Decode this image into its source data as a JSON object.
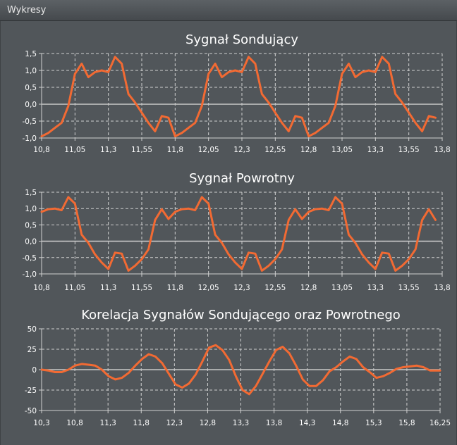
{
  "window": {
    "title": "Wykresy"
  },
  "colors": {
    "series": "#f26a33",
    "zero_line": "#c8c8c8",
    "grid": "#d0d0d0",
    "background": "#51565a"
  },
  "chart_data": [
    {
      "type": "line",
      "title": "Sygnał Sondujący",
      "xlabel": "",
      "ylabel": "",
      "xlim": [
        10.8,
        13.8
      ],
      "ylim": [
        -1.0,
        1.5
      ],
      "xticks": [
        "10,8",
        "11,05",
        "11,3",
        "11,55",
        "11,8",
        "12,05",
        "12,3",
        "12,55",
        "12,8",
        "13,05",
        "13,3",
        "13,55",
        "13,8"
      ],
      "yticks": [
        "1,5",
        "1,0",
        "0,5",
        "0,0",
        "-0,5",
        "-1,0"
      ],
      "grid": true,
      "series": [
        {
          "x": [
            10.8,
            10.85,
            10.9,
            10.95,
            11.0,
            11.05,
            11.1,
            11.15,
            11.2,
            11.25,
            11.3,
            11.35,
            11.4,
            11.45,
            11.5,
            11.55,
            11.6,
            11.65,
            11.7,
            11.75,
            11.8,
            11.85,
            11.9,
            11.95,
            12.0,
            12.05,
            12.1,
            12.15,
            12.2,
            12.25,
            12.3,
            12.35,
            12.4,
            12.45,
            12.5,
            12.55,
            12.6,
            12.65,
            12.7,
            12.75,
            12.8,
            12.85,
            12.9,
            12.95,
            13.0,
            13.05,
            13.1,
            13.15,
            13.2,
            13.25,
            13.3,
            13.35,
            13.4,
            13.45,
            13.5,
            13.55,
            13.6,
            13.65,
            13.7,
            13.75
          ],
          "y": [
            -0.95,
            -0.85,
            -0.7,
            -0.55,
            -0.05,
            0.9,
            1.2,
            0.8,
            0.95,
            1.0,
            0.95,
            1.4,
            1.2,
            0.3,
            0.05,
            -0.25,
            -0.55,
            -0.8,
            -0.35,
            -0.4,
            -0.95,
            -0.85,
            -0.7,
            -0.55,
            -0.05,
            0.9,
            1.2,
            0.8,
            0.95,
            1.0,
            0.95,
            1.4,
            1.2,
            0.3,
            0.05,
            -0.25,
            -0.55,
            -0.8,
            -0.35,
            -0.4,
            -0.95,
            -0.85,
            -0.7,
            -0.55,
            -0.05,
            0.9,
            1.2,
            0.8,
            0.95,
            1.0,
            0.95,
            1.4,
            1.2,
            0.3,
            0.05,
            -0.25,
            -0.55,
            -0.8,
            -0.35,
            -0.4
          ]
        }
      ]
    },
    {
      "type": "line",
      "title": "Sygnał Powrotny",
      "xlabel": "",
      "ylabel": "",
      "xlim": [
        10.8,
        13.8
      ],
      "ylim": [
        -1.0,
        1.5
      ],
      "xticks": [
        "10,8",
        "11,05",
        "11,3",
        "11,55",
        "11,8",
        "12,05",
        "12,3",
        "12,55",
        "12,8",
        "13,05",
        "13,3",
        "13,55",
        "13,8"
      ],
      "yticks": [
        "1,5",
        "1,0",
        "0,5",
        "0,0",
        "-0,5",
        "-1,0"
      ],
      "grid": true,
      "series": [
        {
          "x": [
            10.8,
            10.85,
            10.9,
            10.95,
            11.0,
            11.05,
            11.1,
            11.15,
            11.2,
            11.25,
            11.3,
            11.35,
            11.4,
            11.45,
            11.5,
            11.55,
            11.6,
            11.65,
            11.7,
            11.75,
            11.8,
            11.85,
            11.9,
            11.95,
            12.0,
            12.05,
            12.1,
            12.15,
            12.2,
            12.25,
            12.3,
            12.35,
            12.4,
            12.45,
            12.5,
            12.55,
            12.6,
            12.65,
            12.7,
            12.75,
            12.8,
            12.85,
            12.9,
            12.95,
            13.0,
            13.05,
            13.1,
            13.15,
            13.2,
            13.25,
            13.3,
            13.35,
            13.4,
            13.45,
            13.5,
            13.55,
            13.6,
            13.65,
            13.7,
            13.75
          ],
          "y": [
            0.9,
            0.98,
            1.0,
            0.95,
            1.35,
            1.15,
            0.2,
            -0.05,
            -0.4,
            -0.65,
            -0.85,
            -0.35,
            -0.38,
            -0.9,
            -0.75,
            -0.55,
            -0.25,
            0.65,
            0.98,
            0.68,
            0.9,
            0.98,
            1.0,
            0.95,
            1.35,
            1.15,
            0.2,
            -0.05,
            -0.4,
            -0.65,
            -0.85,
            -0.35,
            -0.38,
            -0.9,
            -0.75,
            -0.55,
            -0.25,
            0.65,
            0.98,
            0.68,
            0.9,
            0.98,
            1.0,
            0.95,
            1.35,
            1.15,
            0.2,
            -0.05,
            -0.4,
            -0.65,
            -0.85,
            -0.35,
            -0.38,
            -0.9,
            -0.75,
            -0.55,
            -0.25,
            0.65,
            0.98,
            0.65
          ]
        }
      ]
    },
    {
      "type": "line",
      "title": "Korelacja Sygnałów Sondującego oraz Powrotnego",
      "xlabel": "",
      "ylabel": "",
      "xlim": [
        10.3,
        16.25
      ],
      "ylim": [
        -50,
        50
      ],
      "xticks": [
        "10,3",
        "10,8",
        "11,3",
        "11,8",
        "12,3",
        "12,8",
        "13,3",
        "13,8",
        "14,3",
        "14,8",
        "15,3",
        "15,8",
        "16,25"
      ],
      "yticks": [
        "50",
        "25",
        "0",
        "-25",
        "-50"
      ],
      "grid": true,
      "series": [
        {
          "x": [
            10.3,
            10.4,
            10.5,
            10.6,
            10.7,
            10.8,
            10.9,
            11.0,
            11.1,
            11.2,
            11.3,
            11.4,
            11.5,
            11.6,
            11.7,
            11.8,
            11.9,
            12.0,
            12.1,
            12.2,
            12.3,
            12.4,
            12.5,
            12.6,
            12.7,
            12.8,
            12.9,
            13.0,
            13.1,
            13.2,
            13.3,
            13.4,
            13.5,
            13.6,
            13.7,
            13.8,
            13.9,
            14.0,
            14.1,
            14.2,
            14.3,
            14.4,
            14.5,
            14.6,
            14.7,
            14.8,
            14.9,
            15.0,
            15.1,
            15.2,
            15.3,
            15.4,
            15.5,
            15.6,
            15.7,
            15.8,
            15.9,
            16.0,
            16.1,
            16.25
          ],
          "y": [
            0,
            -1,
            -3,
            -3,
            0,
            5,
            7,
            6,
            5,
            0,
            -8,
            -12,
            -10,
            -4,
            5,
            13,
            19,
            16,
            8,
            -5,
            -18,
            -22,
            -17,
            -6,
            10,
            27,
            30,
            24,
            12,
            -8,
            -25,
            -30,
            -20,
            -5,
            10,
            24,
            28,
            20,
            5,
            -12,
            -20,
            -20,
            -13,
            -2,
            3,
            10,
            16,
            13,
            3,
            -3,
            -10,
            -8,
            -4,
            1,
            3,
            4,
            5,
            3,
            -1,
            -1
          ]
        }
      ]
    }
  ]
}
